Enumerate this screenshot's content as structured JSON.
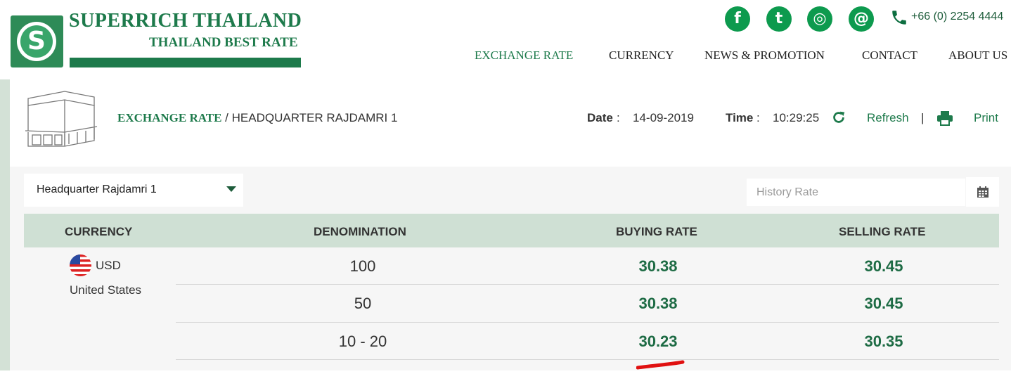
{
  "brand": {
    "logo_letter": "S",
    "title": "SUPERRICH THAILAND",
    "subtitle": "THAILAND BEST RATE",
    "color": "#1d7a4b"
  },
  "social": [
    {
      "icon": "facebook-icon",
      "glyph": "f"
    },
    {
      "icon": "twitter-icon",
      "glyph": "t"
    },
    {
      "icon": "instagram-icon",
      "glyph": "◎"
    },
    {
      "icon": "email-icon",
      "glyph": "@"
    }
  ],
  "phone": {
    "icon": "phone-icon",
    "text": "+66 (0) 2254 4444"
  },
  "nav": [
    {
      "label": "EXCHANGE RATE",
      "active": true
    },
    {
      "label": "CURRENCY",
      "active": false
    },
    {
      "label": "NEWS & PROMOTION",
      "active": false
    },
    {
      "label": "CONTACT",
      "active": false
    },
    {
      "label": "ABOUT US",
      "active": false
    }
  ],
  "breadcrumb": {
    "section": "EXCHANGE RATE",
    "separator": " / ",
    "page": "HEADQUARTER RAJDAMRI 1"
  },
  "meta": {
    "date_label": "Date",
    "date_value": "14-09-2019",
    "time_label": "Time",
    "time_value": "10:29:25",
    "colon": ":",
    "refresh_label": "Refresh",
    "separator": "|",
    "print_label": "Print"
  },
  "branch_select": {
    "value": "Headquarter Rajdamri 1"
  },
  "history": {
    "placeholder": "History Rate"
  },
  "table": {
    "headers": [
      "CURRENCY",
      "DENOMINATION",
      "BUYING RATE",
      "SELLING RATE"
    ],
    "currency": {
      "code": "USD",
      "country": "United States"
    },
    "rows": [
      {
        "denomination": "100",
        "buying": "30.38",
        "selling": "30.45"
      },
      {
        "denomination": "50",
        "buying": "30.38",
        "selling": "30.45"
      },
      {
        "denomination": "10 - 20",
        "buying": "30.23",
        "selling": "30.35"
      }
    ]
  },
  "colors": {
    "accent": "#1d7a4b",
    "header_bg": "#cfe0d4",
    "social": "#0d9a4e"
  }
}
